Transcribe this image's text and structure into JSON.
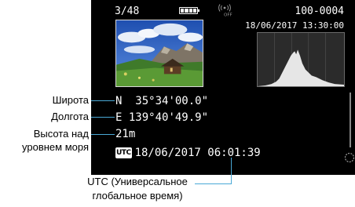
{
  "screen": {
    "frame_counter": "3/48",
    "folder_file": "100-0004",
    "datetime": "18/06/2017 13:30:00",
    "icons": [
      "battery-icon",
      "wifi-off-icon",
      "utc-icon"
    ],
    "gps": {
      "latitude_prefix": "N",
      "latitude": "35°34'00.0\"",
      "longitude_prefix": "E",
      "longitude": "139°40'49.9\"",
      "altitude": "21m",
      "utc_badge": "UTC",
      "utc_time": "18/06/2017 06:01:39"
    }
  },
  "callouts": {
    "latitude": "Широта",
    "longitude": "Долгота",
    "altitude_line1": "Высота над",
    "altitude_line2": "уровнем моря",
    "utc_line1": "UTC (Универсальное",
    "utc_line2": "глобальное время)"
  },
  "colors": {
    "screen_bg": "#000000",
    "leader_line": "#4aa9d6"
  }
}
